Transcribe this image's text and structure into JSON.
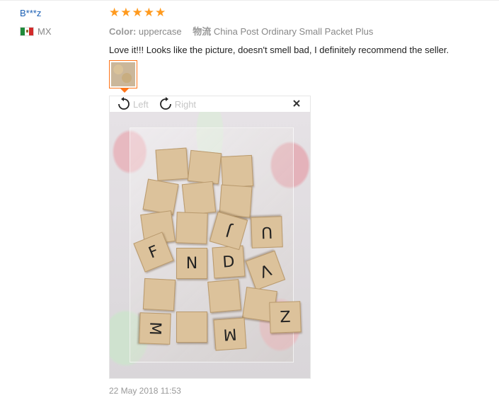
{
  "user": {
    "name": "B***z",
    "country_code": "MX"
  },
  "review": {
    "stars": 5,
    "color_label": "Color:",
    "color_value": "uppercase",
    "shipping_label": "物流",
    "shipping_value": "China Post Ordinary Small Packet Plus",
    "text": "Love it!!! Looks like the picture, doesn't smell bad, I definitely recommend the seller.",
    "date": "22 May 2018 11:53"
  },
  "viewer": {
    "rotate_left_label": "Left",
    "rotate_right_label": "Right",
    "close_label": "×"
  },
  "photo_tiles": [
    {
      "letter": "F"
    },
    {
      "letter": "N"
    },
    {
      "letter": "D"
    },
    {
      "letter": "U"
    },
    {
      "letter": "V"
    },
    {
      "letter": "J"
    },
    {
      "letter": "M"
    },
    {
      "letter": "M"
    },
    {
      "letter": "Z"
    }
  ],
  "colors": {
    "accent": "#ff7519",
    "star": "#ff9a1e",
    "username": "#1a5fb4"
  }
}
